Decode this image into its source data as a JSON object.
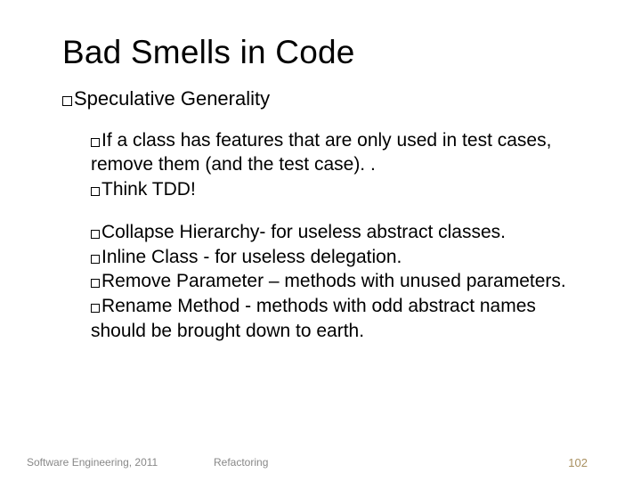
{
  "title": "Bad Smells in Code",
  "level1": {
    "item1": "Speculative Generality"
  },
  "group1": {
    "item1": "If a class has features that are only used in test cases, remove them (and the test case). .",
    "item2": "Think TDD!"
  },
  "group2": {
    "item1": "Collapse Hierarchy- for useless abstract classes.",
    "item2": "Inline Class - for useless delegation.",
    "item3": "Remove Parameter – methods with unused parameters.",
    "item4": "Rename Method - methods with odd abstract names should be brought down to earth."
  },
  "footer": {
    "left": "Software Engineering, 2011",
    "mid": "Refactoring",
    "right": "102"
  }
}
